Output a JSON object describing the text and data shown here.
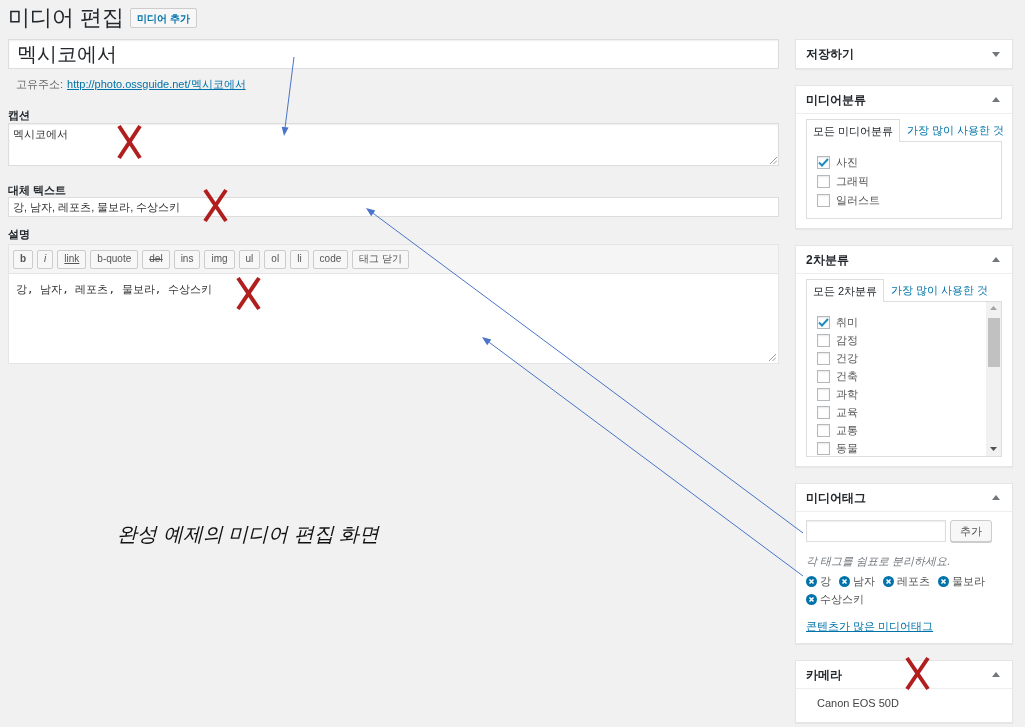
{
  "header": {
    "title": "미디어 편집",
    "add_button": "미디어 추가"
  },
  "title_field": {
    "value": "멕시코에서"
  },
  "permalink": {
    "label": "고유주소:",
    "url": "http://photo.ossguide.net/멕시코에서"
  },
  "caption_field": {
    "label": "캡션",
    "value": "멕시코에서"
  },
  "alt_text_field": {
    "label": "대체 텍스트",
    "value": "강, 남자, 레포츠, 물보라, 수상스키"
  },
  "description": {
    "label": "설명",
    "toolbar": [
      {
        "label": "b",
        "kind": "bold"
      },
      {
        "label": "i",
        "kind": "italic"
      },
      {
        "label": "link",
        "kind": "link"
      },
      {
        "label": "b-quote",
        "kind": "plain"
      },
      {
        "label": "del",
        "kind": "strike"
      },
      {
        "label": "ins",
        "kind": "plain"
      },
      {
        "label": "img",
        "kind": "plain"
      },
      {
        "label": "ul",
        "kind": "plain"
      },
      {
        "label": "ol",
        "kind": "plain"
      },
      {
        "label": "li",
        "kind": "plain"
      },
      {
        "label": "code",
        "kind": "plain"
      },
      {
        "label": "태그 닫기",
        "kind": "plain"
      }
    ],
    "value": "강, 남자, 레포츠, 물보라, 수상스키"
  },
  "figure_caption": "완성 예제의 미디어 편집 화면",
  "sidebar": [
    {
      "kind": "plain",
      "title": "저장하기",
      "expanded": false
    },
    {
      "kind": "categories",
      "title": "미디어분류",
      "expanded": true,
      "scrollable": false,
      "tabs": [
        {
          "label": "모든 미디어분류",
          "selected": true
        },
        {
          "label": "가장 많이 사용한 것",
          "selected": false
        }
      ],
      "items": [
        {
          "label": "사진",
          "checked": true
        },
        {
          "label": "그래픽",
          "checked": false
        },
        {
          "label": "일러스트",
          "checked": false
        }
      ]
    },
    {
      "kind": "categories",
      "title": "2차분류",
      "expanded": true,
      "scrollable": true,
      "tabs": [
        {
          "label": "모든 2차분류",
          "selected": true
        },
        {
          "label": "가장 많이 사용한 것",
          "selected": false
        }
      ],
      "items": [
        {
          "label": "취미",
          "checked": true
        },
        {
          "label": "감정",
          "checked": false
        },
        {
          "label": "건강",
          "checked": false
        },
        {
          "label": "건축",
          "checked": false
        },
        {
          "label": "과학",
          "checked": false
        },
        {
          "label": "교육",
          "checked": false
        },
        {
          "label": "교통",
          "checked": false
        },
        {
          "label": "동물",
          "checked": false
        }
      ]
    },
    {
      "kind": "tags",
      "title": "미디어태그",
      "expanded": true,
      "add_button": "추가",
      "hint": "각 태그를 쉼표로 분리하세요.",
      "tags": [
        "강",
        "남자",
        "레포츠",
        "물보라",
        "수상스키"
      ],
      "link": "콘텐츠가 많은 미디어태그"
    },
    {
      "kind": "text",
      "title": "카메라",
      "expanded": true,
      "value": "Canon EOS 50D"
    }
  ]
}
